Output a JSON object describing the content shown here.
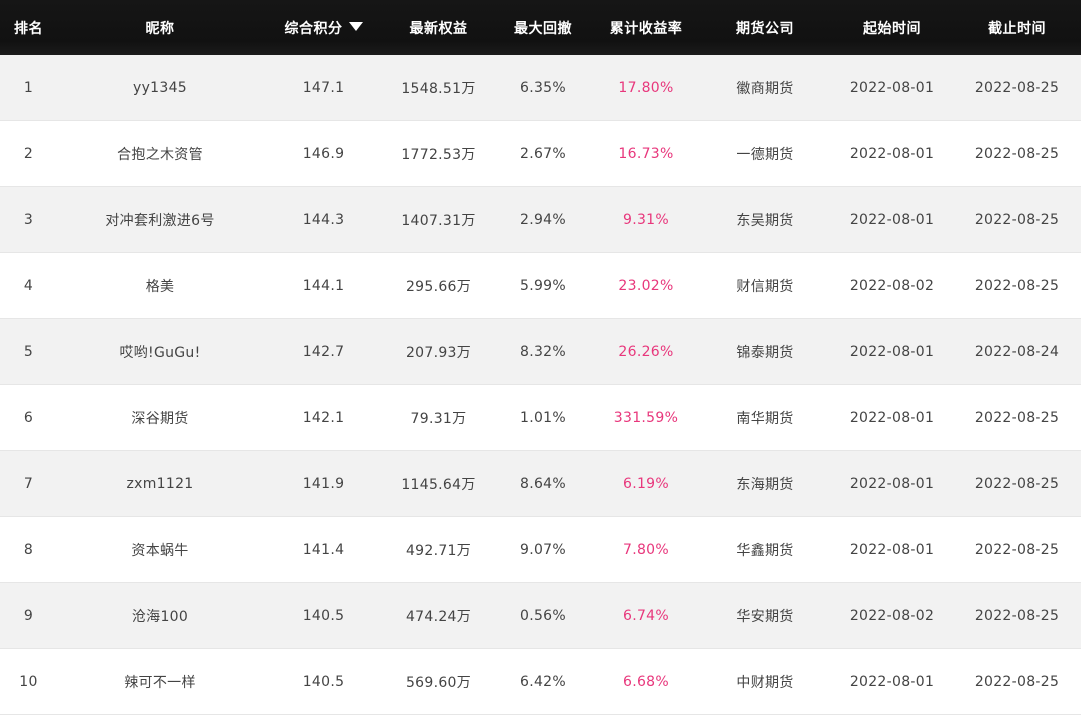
{
  "headers": [
    "排名",
    "昵称",
    "综合积分",
    "最新权益",
    "最大回撤",
    "累计收益率",
    "期货公司",
    "起始时间",
    "截止时间"
  ],
  "rows": [
    [
      "1",
      "yy1345",
      "147.1",
      "1548.51万",
      "6.35%",
      "17.80%",
      "徽商期货",
      "2022-08-01",
      "2022-08-25"
    ],
    [
      "2",
      "合抱之木资管",
      "146.9",
      "1772.53万",
      "2.67%",
      "16.73%",
      "一德期货",
      "2022-08-01",
      "2022-08-25"
    ],
    [
      "3",
      "对冲套利激进6号",
      "144.3",
      "1407.31万",
      "2.94%",
      "9.31%",
      "东吴期货",
      "2022-08-01",
      "2022-08-25"
    ],
    [
      "4",
      "格美",
      "144.1",
      "295.66万",
      "5.99%",
      "23.02%",
      "财信期货",
      "2022-08-02",
      "2022-08-25"
    ],
    [
      "5",
      "哎哟!GuGu!",
      "142.7",
      "207.93万",
      "8.32%",
      "26.26%",
      "锦泰期货",
      "2022-08-01",
      "2022-08-24"
    ],
    [
      "6",
      "深谷期货",
      "142.1",
      "79.31万",
      "1.01%",
      "331.59%",
      "南华期货",
      "2022-08-01",
      "2022-08-25"
    ],
    [
      "7",
      "zxm1121",
      "141.9",
      "1145.64万",
      "8.64%",
      "6.19%",
      "东海期货",
      "2022-08-01",
      "2022-08-25"
    ],
    [
      "8",
      "资本蜗牛",
      "141.4",
      "492.71万",
      "9.07%",
      "7.80%",
      "华鑫期货",
      "2022-08-01",
      "2022-08-25"
    ],
    [
      "9",
      "沧海100",
      "140.5",
      "474.24万",
      "0.56%",
      "6.74%",
      "华安期货",
      "2022-08-02",
      "2022-08-25"
    ],
    [
      "10",
      "辣可不一样",
      "140.5",
      "569.60万",
      "6.42%",
      "6.68%",
      "中财期货",
      "2022-08-01",
      "2022-08-25"
    ]
  ],
  "sort": {
    "column": "综合积分",
    "direction": "descending",
    "icon": "sort-desc-icon"
  },
  "colors": {
    "header_bg": "#111111",
    "header_text": "#ffffff",
    "row_odd": "#f2f2f2",
    "row_even": "#ffffff",
    "text": "#444444",
    "return": "#e8377c"
  }
}
